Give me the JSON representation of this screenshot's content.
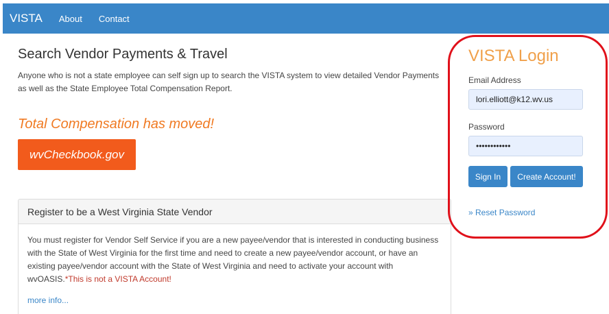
{
  "nav": {
    "brand": "VISTA",
    "links": [
      "About",
      "Contact"
    ]
  },
  "main": {
    "title": "Search Vendor Payments & Travel",
    "intro": "Anyone who is not a state employee can self sign up to search the VISTA system to view detailed Vendor Payments as well as the State Employee Total Compensation Report.",
    "moved_notice": "Total Compensation has moved!",
    "checkbook_button": "wvCheckbook.gov"
  },
  "panel": {
    "heading": "Register to be a West Virginia State Vendor",
    "body": "You must register for Vendor Self Service if you are a new payee/vendor that is interested in conducting business with the State of West Virginia for the first time and need to create a new payee/vendor account, or have an existing payee/vendor account with the State of West Virginia and need to activate your account with wvOASIS.",
    "warning": "*This is not a VISTA Account!",
    "more_info": "more info..."
  },
  "login": {
    "title": "VISTA Login",
    "email_label": "Email Address",
    "email_value": "lori.elliott@k12.wv.us",
    "password_label": "Password",
    "password_value": "••••••••••••",
    "sign_in": "Sign In",
    "create_account": "Create Account!",
    "reset_password": "» Reset Password"
  },
  "colors": {
    "navbar": "#3a86c8",
    "accent_orange": "#f07a22",
    "button_orange": "#f25b1c",
    "highlight_circle": "#e0101a"
  }
}
